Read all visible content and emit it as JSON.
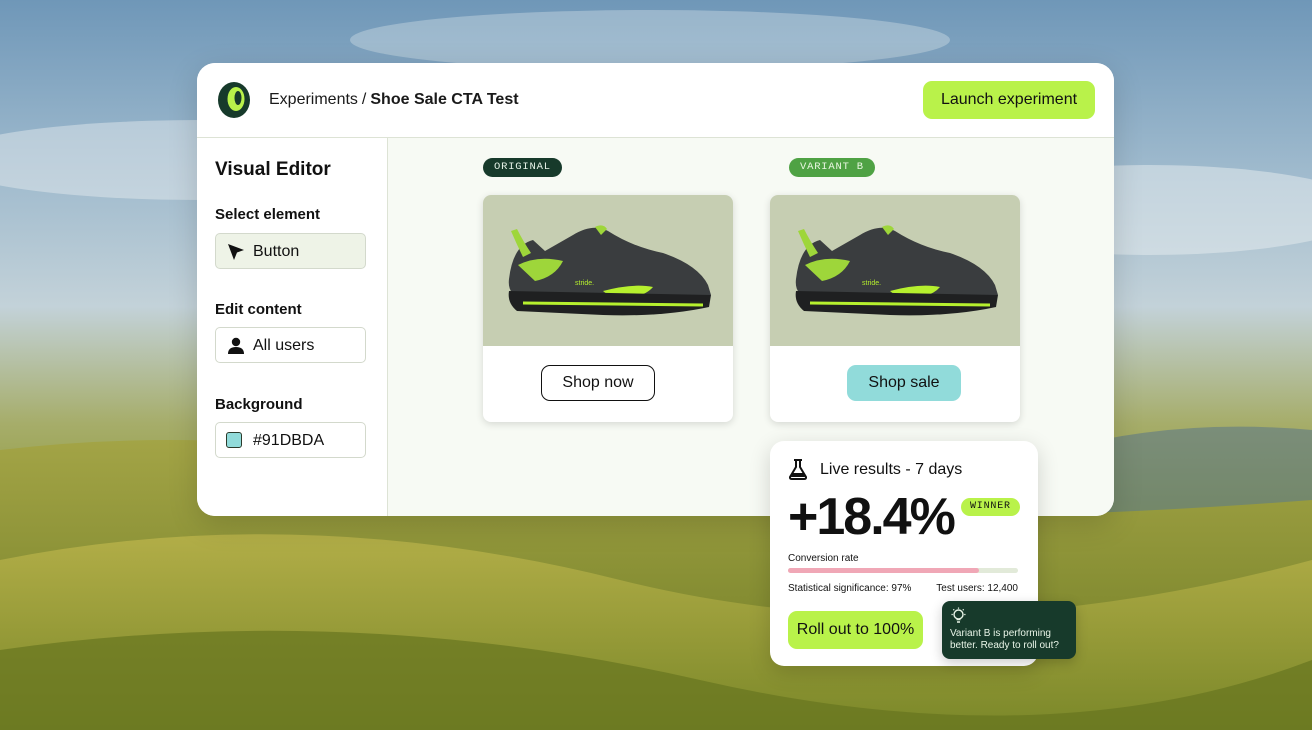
{
  "header": {
    "breadcrumb_root": "Experiments",
    "breadcrumb_separator": "/",
    "breadcrumb_current": "Shoe Sale CTA Test",
    "launch_label": "Launch experiment"
  },
  "sidebar": {
    "title": "Visual Editor",
    "select_element_label": "Select element",
    "select_element_value": "Button",
    "edit_content_label": "Edit content",
    "edit_content_value": "All users",
    "background_label": "Background",
    "background_value": "#91DBDA"
  },
  "variants": {
    "original": {
      "tag": "ORIGINAL",
      "cta_label": "Shop now"
    },
    "variant_b": {
      "tag": "VARIANT B",
      "cta_label": "Shop sale"
    }
  },
  "results": {
    "title": "Live results - 7 days",
    "lift": "+18.4%",
    "badge": "WINNER",
    "metric_label": "Conversion rate",
    "conversion_bar_fraction": 0.83,
    "significance": "Statistical significance: 97%",
    "test_users": "Test users: 12,400",
    "rollout_label": "Roll out to 100%"
  },
  "tooltip": {
    "message": "Variant B is performing better. Ready to roll out?"
  },
  "colors": {
    "accent": "#b9f24a",
    "dark_green": "#173a2b",
    "variant_green": "#4fa244",
    "variant_button": "#91DBDA",
    "conversion_bar": "#f0a7b6"
  },
  "icons": {
    "logo": "logo-icon",
    "select_element": "cursor-arrow-icon",
    "edit_content": "user-icon",
    "results": "flask-icon",
    "tooltip": "lightbulb-icon"
  }
}
